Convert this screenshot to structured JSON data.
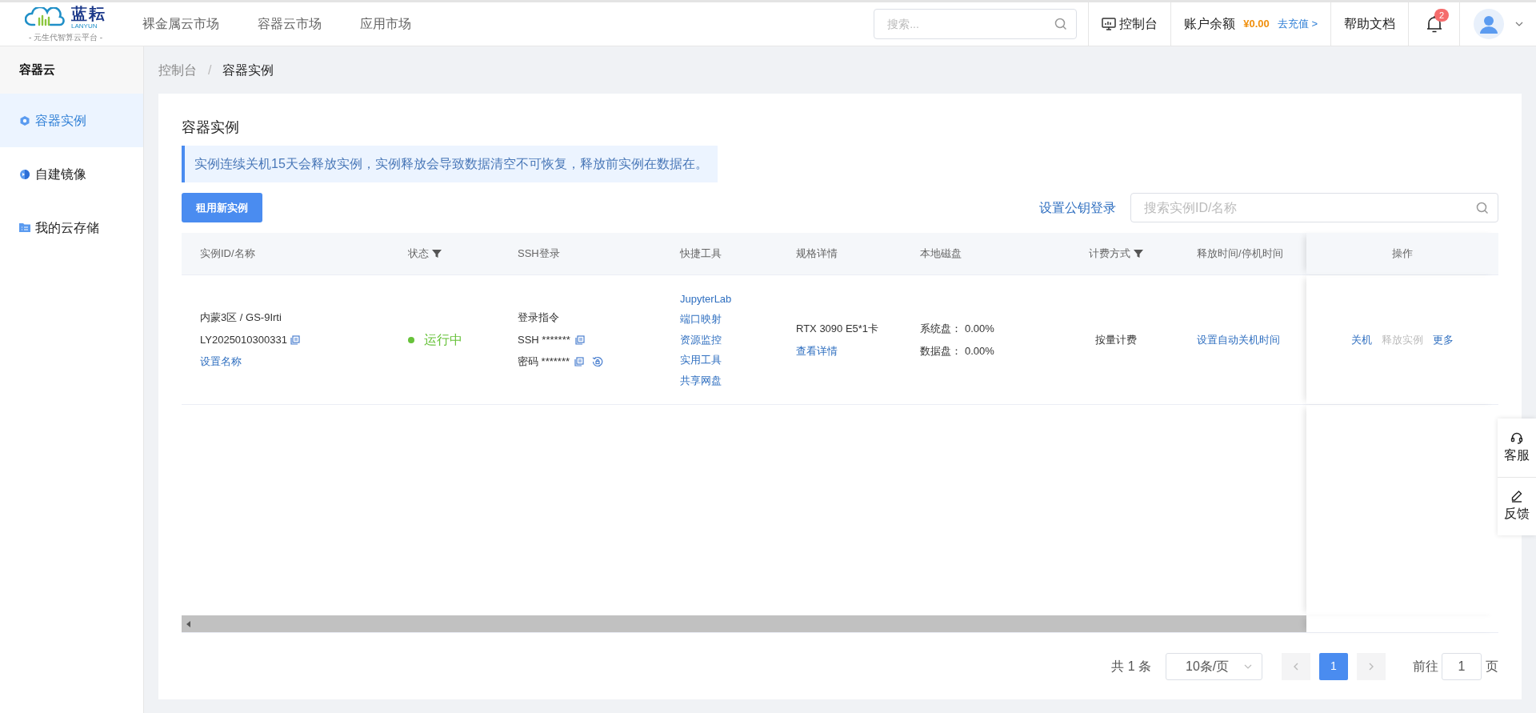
{
  "header": {
    "logo": {
      "name": "蓝耘",
      "latin": "LANYUN",
      "slogan": "- 元生代智算云平台 -"
    },
    "nav": [
      "裸金属云市场",
      "容器云市场",
      "应用市场"
    ],
    "search": {
      "placeholder": "搜索..."
    },
    "console": "控制台",
    "balance": {
      "label": "账户余额",
      "amount": "¥0.00",
      "recharge": "去充值 >"
    },
    "help": "帮助文档",
    "notifications": "2"
  },
  "sidebar": {
    "title": "容器云",
    "items": [
      {
        "label": "容器实例",
        "selected": true
      },
      {
        "label": "自建镜像",
        "selected": false
      },
      {
        "label": "我的云存储",
        "selected": false
      }
    ]
  },
  "breadcrumb": {
    "separator": "/",
    "items": [
      "控制台",
      "容器实例"
    ]
  },
  "card": {
    "title": "容器实例",
    "notice": "实例连续关机15天会释放实例，实例释放会导致数据清空不可恢复，释放前实例在数据在。",
    "new_button": "租用新实例",
    "key_login": "设置公钥登录",
    "search": {
      "placeholder": "搜索实例ID/名称"
    }
  },
  "table": {
    "columns": [
      {
        "label": "实例ID/名称",
        "filter": false
      },
      {
        "label": "状态",
        "filter": true
      },
      {
        "label": "SSH登录",
        "filter": false
      },
      {
        "label": "快捷工具",
        "filter": false
      },
      {
        "label": "规格详情",
        "filter": false
      },
      {
        "label": "本地磁盘",
        "filter": false
      },
      {
        "label": "计费方式",
        "filter": true
      },
      {
        "label": "释放时间/停机时间",
        "filter": false
      },
      {
        "label": "操作",
        "filter": false
      }
    ],
    "rows": [
      {
        "instance": {
          "name": "内蒙3区 / GS-9Irti",
          "id": "LY2025010300331",
          "set_name": "设置名称"
        },
        "status": {
          "text": "运行中",
          "kind": "running"
        },
        "ssh": {
          "label": "登录指令",
          "command": "SSH *******",
          "password": "密码 *******"
        },
        "tools": [
          "JupyterLab",
          "端口映射",
          "资源监控",
          "实用工具",
          "共享网盘"
        ],
        "spec": {
          "text": "RTX 3090 E5*1卡",
          "link": "查看详情"
        },
        "disks": [
          {
            "label": "系统盘：",
            "value": "0.00%"
          },
          {
            "label": "数据盘：",
            "value": "0.00%"
          }
        ],
        "billing": "按量计费",
        "release": "设置自动关机时间",
        "actions": [
          {
            "label": "关机",
            "disabled": false
          },
          {
            "label": "释放实例",
            "disabled": true
          },
          {
            "label": "更多",
            "disabled": false
          }
        ]
      }
    ]
  },
  "pagination": {
    "total": "共 1 条",
    "page_size": "10条/页",
    "pages": [
      {
        "label": "1",
        "selected": true
      }
    ],
    "goto": "前往",
    "goto_value": "1",
    "page_unit": "页"
  },
  "float_buttons": [
    {
      "label": "客服"
    },
    {
      "label": "反馈"
    }
  ]
}
